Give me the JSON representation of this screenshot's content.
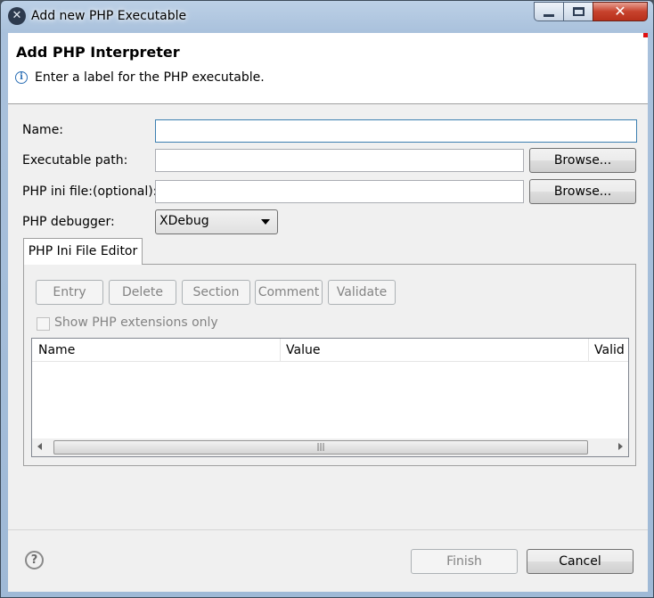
{
  "window": {
    "title": "Add new PHP Executable",
    "icon": "eclipse-pdt-icon",
    "controls": {
      "minimize": "minimize-icon",
      "maximize": "maximize-icon",
      "close": "✕"
    }
  },
  "banner": {
    "title": "Add PHP Interpreter",
    "message": "Enter a label for the PHP executable."
  },
  "form": {
    "name_label": "Name:",
    "name_value": "",
    "exec_path_label": "Executable path:",
    "exec_path_value": "",
    "browse_label": "Browse...",
    "ini_label": "PHP ini file:(optional):",
    "ini_value": "",
    "debugger_label": "PHP debugger:",
    "debugger_value": "XDebug"
  },
  "ini_editor": {
    "tab_label": "PHP Ini File Editor",
    "buttons": [
      "Entry",
      "Delete",
      "Section",
      "Comment",
      "Validate"
    ],
    "checkbox_label": "Show PHP extensions only",
    "checkbox_checked": false,
    "columns": [
      "Name",
      "Value",
      "Valid"
    ],
    "scroll_thumb_grip": "|||"
  },
  "footer": {
    "help_icon": "?",
    "finish_label": "Finish",
    "cancel_label": "Cancel"
  },
  "colors": {
    "focus_border": "#3c7fb1",
    "disabled_text": "#838383",
    "close_button": "#c7422d"
  }
}
